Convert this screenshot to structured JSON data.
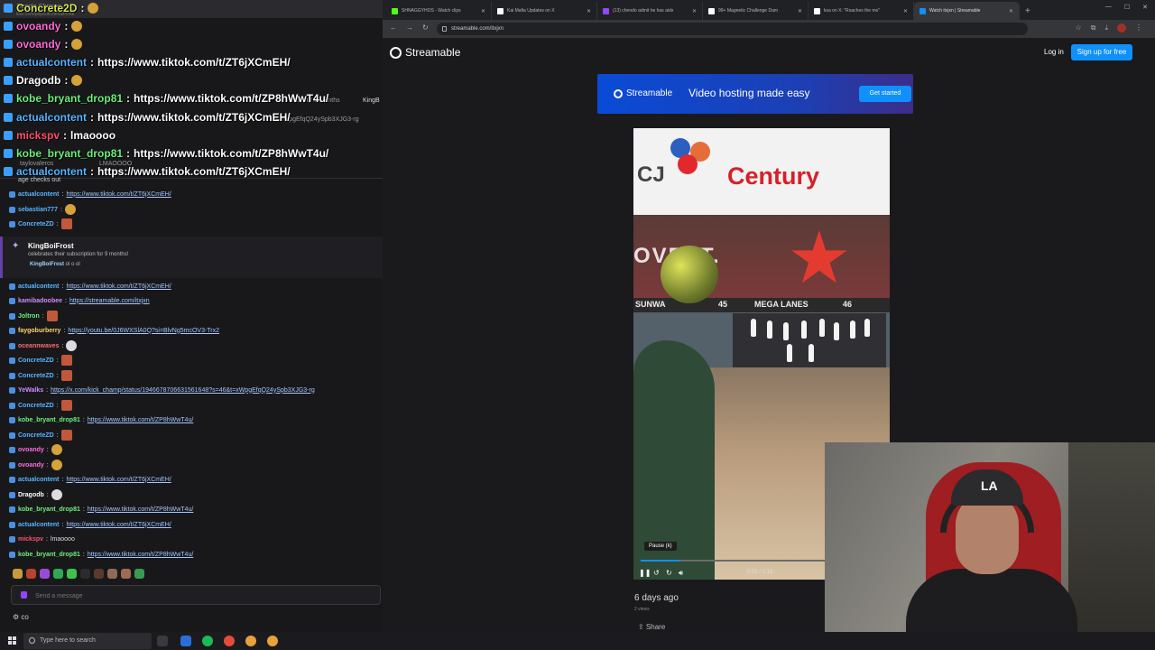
{
  "chat": {
    "window_title": "Google Chrome",
    "window_address": "kick.com/popout/chevalr/chat",
    "overlay_lines": [
      {
        "user": "Concrete2D",
        "user_color": "#d6e84f",
        "text": ""
      },
      {
        "user": "ovoandy",
        "user_color": "#ff6bd9",
        "text": ""
      },
      {
        "user": "ovoandy",
        "user_color": "#ff6bd9",
        "text": ""
      },
      {
        "user": "actualcontent",
        "user_color": "#57b5ff",
        "text": "https://www.tiktok.com/t/ZT6jXCmEH/"
      },
      {
        "user": "Dragodb",
        "user_color": "#ffffff",
        "text": ""
      },
      {
        "user": "kobe_bryant_drop81",
        "user_color": "#6cf07a",
        "text": "https://www.tiktok.com/t/ZP8hWwT4u/"
      },
      {
        "user": "actualcontent",
        "user_color": "#57b5ff",
        "text": "https://www.tiktok.com/t/ZT6jXCmEH/"
      },
      {
        "user": "mickspv",
        "user_color": "#ff4f6d",
        "text": "lmaoooo"
      },
      {
        "user": "kobe_bryant_drop81",
        "user_color": "#6cf07a",
        "text": "https://www.tiktok.com/t/ZP8hWwT4u/"
      },
      {
        "user": "actualcontent",
        "user_color": "#57b5ff",
        "text": "https://www.tiktok.com/t/ZT6jXCmEH/"
      }
    ],
    "overlay_fragments": {
      "sub_months": "ed for 9 months",
      "kingb": "KingB",
      "tail_link": "=xWpgEfqQ24ySpb3XJG3-rg",
      "taylor": "taylovaleros",
      "lmao_small": "LMAOOOO",
      "age_check": "age checks out"
    },
    "messages": [
      {
        "user": "actualcontent",
        "color": "#57b5ff",
        "text": "https://www.tiktok.com/t/ZT6jXCmEH/",
        "emote": ""
      },
      {
        "user": "sebastian777",
        "color": "#57b5ff",
        "text": "",
        "emote": "y"
      },
      {
        "user": "ConcreteZD",
        "color": "#57b5ff",
        "text": "",
        "emote": "r"
      },
      {
        "user": "actualcontent",
        "color": "#57b5ff",
        "text": "https://www.tiktok.com/t/ZT6jXCmEH/",
        "emote": ""
      },
      {
        "user": "kamibadoobee",
        "color": "#d18bff",
        "text": "https://streamable.com/itxjxn",
        "emote": ""
      },
      {
        "user": "Joltron",
        "color": "#6cf07a",
        "text": "",
        "emote": "r"
      },
      {
        "user": "faygoburberry",
        "color": "#ffd66b",
        "text": "https://youtu.be/0J6WXSlA0Q?si=BlvNg5mcOV3-Trx2",
        "emote": ""
      },
      {
        "user": "oceannwaves",
        "color": "#ff6b6b",
        "text": "",
        "emote": "w"
      },
      {
        "user": "ConcreteZD",
        "color": "#57b5ff",
        "text": "",
        "emote": "r"
      },
      {
        "user": "ConcreteZD",
        "color": "#57b5ff",
        "text": "",
        "emote": "r"
      },
      {
        "user": "YeWalks",
        "color": "#d18bff",
        "text": "https://x.com/kick_champ/status/1946678706631561648?s=46&t=xWpgEfqQ24ySpb3XJG3-rg",
        "emote": ""
      },
      {
        "user": "ConcreteZD",
        "color": "#57b5ff",
        "text": "",
        "emote": "r"
      },
      {
        "user": "kobe_bryant_drop81",
        "color": "#6cf07a",
        "text": "https://www.tiktok.com/t/ZP8hWwT4u/",
        "emote": ""
      },
      {
        "user": "ConcreteZD",
        "color": "#57b5ff",
        "text": "",
        "emote": "r"
      },
      {
        "user": "ovoandy",
        "color": "#ff6bd9",
        "text": "",
        "emote": "y"
      },
      {
        "user": "ovoandy",
        "color": "#ff6bd9",
        "text": "",
        "emote": "y"
      },
      {
        "user": "actualcontent",
        "color": "#57b5ff",
        "text": "https://www.tiktok.com/t/ZT6jXCmEH/",
        "emote": ""
      },
      {
        "user": "Dragodb",
        "color": "#ffffff",
        "text": "",
        "emote": "w"
      },
      {
        "user": "kobe_bryant_drop81",
        "color": "#6cf07a",
        "text": "https://www.tiktok.com/t/ZP8hWwT4u/",
        "emote": ""
      },
      {
        "user": "actualcontent",
        "color": "#57b5ff",
        "text": "https://www.tiktok.com/t/ZT6jXCmEH/",
        "emote": ""
      },
      {
        "user": "mickspv",
        "color": "#ff4f6d",
        "text": "lmaoooo",
        "emote": ""
      },
      {
        "user": "kobe_bryant_drop81",
        "color": "#6cf07a",
        "text": "https://www.tiktok.com/t/ZP8hWwT4u/",
        "emote": ""
      }
    ],
    "sub_event": {
      "user": "KingBoiFrost",
      "desc": "celebrates their subscription for 9 months!",
      "extra_user": "KingBoiFrost",
      "extra_text": "ol o ol"
    },
    "input_placeholder": "Send a message",
    "settings_label": "co"
  },
  "browser": {
    "tabs": [
      {
        "label": "SHNAGGYHOS - Watch clips",
        "color": "#53fc18",
        "active": false
      },
      {
        "label": "Kai Mafia Updates on X",
        "color": "#ffffff",
        "active": false
      },
      {
        "label": "(13) chendo admit he has aids",
        "color": "#9146ff",
        "active": false
      },
      {
        "label": "99+ Magnetic Challenge Dam",
        "color": "#ffffff",
        "active": false
      },
      {
        "label": "ksa on X: \"Roaches the mo\"",
        "color": "#ffffff",
        "active": false
      },
      {
        "label": "Watch itxjxn | Streamable",
        "color": "#0f90fa",
        "active": true
      }
    ],
    "url": "streamable.com/itxjxn"
  },
  "page": {
    "brand": "Streamable",
    "login": "Log in",
    "signup": "Sign up for free",
    "promo": {
      "brand": "Streamable",
      "tagline": "Video hosting made easy",
      "cta": "Get started"
    },
    "video": {
      "banner_left": "CJ",
      "banner_right": "Century",
      "sign_text": "OVE IT.",
      "lane_left": "SUNWA",
      "lane_num_a": "45",
      "lane_mid": "MEGA LANES",
      "lane_num_b": "46",
      "tooltip": "Pause (k)",
      "time": "0:03 / 0:19",
      "progress": 0.16
    },
    "date": "6 days ago",
    "views": "2 views",
    "share": "Share"
  },
  "webcam": {
    "cap_logo": "LA"
  },
  "taskbar": {
    "search_placeholder": "Type here to search"
  }
}
